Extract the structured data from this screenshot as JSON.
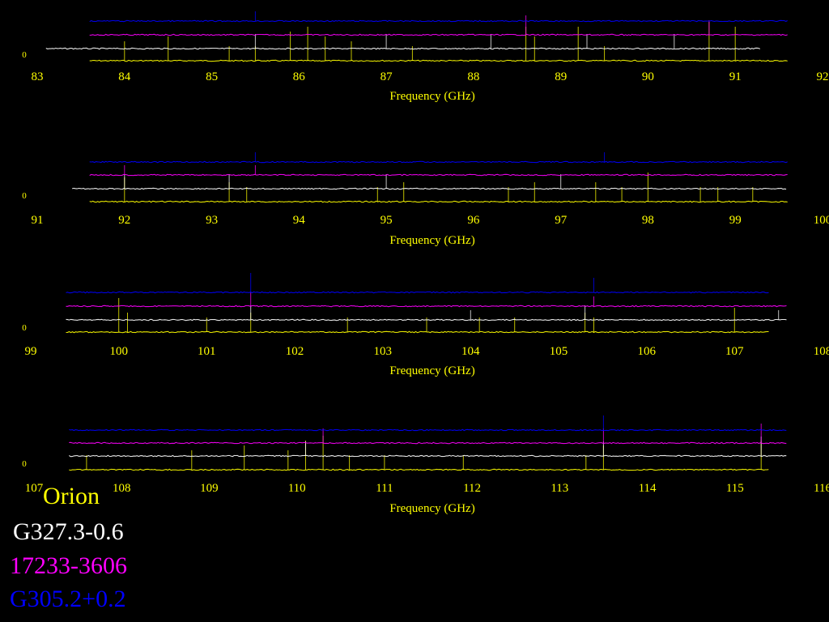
{
  "colors": {
    "background": "#000000",
    "orion": "#ffff00",
    "g327": "#ffffff",
    "s17233": "#ff00ff",
    "g305": "#0000ff",
    "axis_text": "#ffff00"
  },
  "legend": {
    "items": [
      {
        "label": "Orion",
        "color": "#ffff00"
      },
      {
        "label": "G327.3-0.6",
        "color": "#ffffff"
      },
      {
        "label": "17233-3606",
        "color": "#ff00ff"
      },
      {
        "label": "G305.2+0.2",
        "color": "#0000ff"
      }
    ]
  },
  "chart_data": [
    {
      "type": "line",
      "xlabel": "Frequency (GHz)",
      "ylabel": "",
      "xlim": [
        83,
        92
      ],
      "x_ticks": [
        "83",
        "84",
        "85",
        "86",
        "87",
        "88",
        "89",
        "90",
        "91",
        "92"
      ],
      "y_tick": "0",
      "series": [
        {
          "color": "#ffff00",
          "x_range": [
            83.6,
            91.6
          ],
          "offset": 3,
          "lines": [
            [
              84.0,
              4
            ],
            [
              84.5,
              5
            ],
            [
              85.2,
              3
            ],
            [
              85.5,
              3
            ],
            [
              85.9,
              6
            ],
            [
              86.1,
              7
            ],
            [
              86.3,
              5
            ],
            [
              86.6,
              4
            ],
            [
              87.3,
              3
            ],
            [
              88.6,
              7
            ],
            [
              88.7,
              5
            ],
            [
              89.2,
              7
            ],
            [
              89.5,
              3
            ],
            [
              90.7,
              8
            ],
            [
              91.0,
              7
            ]
          ]
        },
        {
          "color": "#ffffff",
          "x_range": [
            83.1,
            91.3
          ],
          "offset": 2,
          "lines": [
            [
              85.5,
              3
            ],
            [
              87.0,
              3
            ],
            [
              88.2,
              3
            ],
            [
              89.3,
              3
            ],
            [
              90.3,
              3
            ]
          ]
        },
        {
          "color": "#ff00ff",
          "x_range": [
            83.6,
            91.6
          ],
          "offset": 1,
          "lines": [
            [
              88.6,
              4
            ],
            [
              90.7,
              3
            ]
          ]
        },
        {
          "color": "#0000ff",
          "x_range": [
            83.6,
            91.6
          ],
          "offset": 0,
          "lines": [
            [
              85.5,
              2
            ]
          ]
        }
      ]
    },
    {
      "type": "line",
      "xlabel": "Frequency (GHz)",
      "ylabel": "",
      "xlim": [
        91,
        100
      ],
      "x_ticks": [
        "91",
        "92",
        "93",
        "94",
        "95",
        "96",
        "97",
        "98",
        "99",
        "100"
      ],
      "y_tick": "0",
      "series": [
        {
          "color": "#ffff00",
          "x_range": [
            91.6,
            99.6
          ],
          "offset": 3,
          "lines": [
            [
              92.0,
              5
            ],
            [
              93.2,
              4
            ],
            [
              93.4,
              3
            ],
            [
              94.9,
              3
            ],
            [
              95.2,
              4
            ],
            [
              96.4,
              3
            ],
            [
              96.7,
              4
            ],
            [
              97.4,
              4
            ],
            [
              97.7,
              3
            ],
            [
              98.0,
              6
            ],
            [
              98.6,
              3
            ],
            [
              98.8,
              3
            ],
            [
              99.2,
              3
            ]
          ]
        },
        {
          "color": "#ffffff",
          "x_range": [
            91.4,
            99.6
          ],
          "offset": 2,
          "lines": [
            [
              92.0,
              3
            ],
            [
              93.2,
              3
            ],
            [
              95.0,
              3
            ],
            [
              97.0,
              3
            ]
          ]
        },
        {
          "color": "#ff00ff",
          "x_range": [
            91.6,
            99.6
          ],
          "offset": 1,
          "lines": [
            [
              92.0,
              2
            ],
            [
              93.5,
              2
            ]
          ]
        },
        {
          "color": "#0000ff",
          "x_range": [
            91.6,
            99.6
          ],
          "offset": 0,
          "lines": [
            [
              93.5,
              2
            ],
            [
              97.5,
              2
            ]
          ]
        }
      ]
    },
    {
      "type": "line",
      "xlabel": "Frequency (GHz)",
      "ylabel": "",
      "xlim": [
        99,
        108
      ],
      "x_ticks": [
        "99",
        "100",
        "101",
        "102",
        "103",
        "104",
        "105",
        "106",
        "107",
        "108"
      ],
      "y_tick": "0",
      "series": [
        {
          "color": "#ffff00",
          "x_range": [
            99.4,
            107.4
          ],
          "offset": 3,
          "lines": [
            [
              100.0,
              7
            ],
            [
              100.1,
              4
            ],
            [
              101.0,
              3
            ],
            [
              101.5,
              4
            ],
            [
              102.6,
              3
            ],
            [
              103.5,
              3
            ],
            [
              104.1,
              3
            ],
            [
              104.5,
              3
            ],
            [
              105.3,
              4
            ],
            [
              105.4,
              3
            ],
            [
              107.0,
              5
            ]
          ]
        },
        {
          "color": "#ffffff",
          "x_range": [
            99.4,
            107.6
          ],
          "offset": 2,
          "lines": [
            [
              101.5,
              3
            ],
            [
              104.0,
              2
            ],
            [
              105.3,
              3
            ],
            [
              107.5,
              2
            ]
          ]
        },
        {
          "color": "#ff00ff",
          "x_range": [
            99.4,
            107.6
          ],
          "offset": 1,
          "lines": [
            [
              101.5,
              3
            ],
            [
              105.4,
              2
            ]
          ]
        },
        {
          "color": "#0000ff",
          "x_range": [
            99.4,
            107.4
          ],
          "offset": 0,
          "lines": [
            [
              101.5,
              4
            ],
            [
              105.4,
              3
            ]
          ]
        }
      ]
    },
    {
      "type": "line",
      "xlabel": "Frequency (GHz)",
      "ylabel": "",
      "xlim": [
        107,
        116
      ],
      "x_ticks": [
        "107",
        "108",
        "109",
        "110",
        "111",
        "112",
        "113",
        "114",
        "115",
        "116"
      ],
      "y_tick": "0",
      "series": [
        {
          "color": "#ffff00",
          "x_range": [
            107.4,
            115.4
          ],
          "offset": 3,
          "lines": [
            [
              107.6,
              3
            ],
            [
              108.8,
              4
            ],
            [
              109.4,
              5
            ],
            [
              109.9,
              4
            ],
            [
              110.1,
              6
            ],
            [
              110.3,
              7
            ],
            [
              110.6,
              3
            ],
            [
              111.0,
              3
            ],
            [
              111.9,
              3
            ],
            [
              113.3,
              3
            ],
            [
              113.5,
              5
            ],
            [
              115.3,
              6
            ]
          ]
        },
        {
          "color": "#ffffff",
          "x_range": [
            107.4,
            115.6
          ],
          "offset": 2,
          "lines": [
            [
              110.1,
              3
            ],
            [
              113.5,
              3
            ],
            [
              115.3,
              4
            ]
          ]
        },
        {
          "color": "#ff00ff",
          "x_range": [
            107.4,
            115.6
          ],
          "offset": 1,
          "lines": [
            [
              110.3,
              3
            ],
            [
              113.5,
              3
            ],
            [
              115.3,
              4
            ]
          ]
        },
        {
          "color": "#0000ff",
          "x_range": [
            107.4,
            115.6
          ],
          "offset": 0,
          "lines": [
            [
              113.5,
              3
            ]
          ]
        }
      ]
    }
  ]
}
